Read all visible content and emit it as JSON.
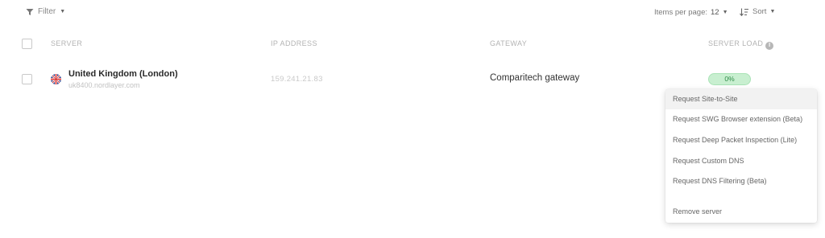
{
  "toolbar": {
    "filter_label": "Filter",
    "items_per_page_label": "Items per page:",
    "items_per_page_value": "12",
    "sort_label": "Sort"
  },
  "table": {
    "columns": [
      "SERVER",
      "IP ADDRESS",
      "GATEWAY",
      "SERVER LOAD"
    ],
    "rows": [
      {
        "country": "United Kingdom (London)",
        "hostname": "uk8400.nordlayer.com",
        "ip": "159.241.21.83",
        "gateway": "Comparitech gateway",
        "load": "0%"
      }
    ]
  },
  "context_menu": {
    "items": [
      "Request Site-to-Site",
      "Request SWG Browser extension (Beta)",
      "Request Deep Packet Inspection (Lite)",
      "Request Custom DNS",
      "Request DNS Filtering (Beta)",
      "Remove server"
    ]
  },
  "colors": {
    "load_pill_bg": "#c8efd0",
    "load_pill_text": "#2e8b47",
    "menu_active_bg": "#f2f2f2"
  },
  "icons": [
    "filter-icon",
    "sort-icon",
    "info-icon",
    "uk-flag-icon"
  ]
}
